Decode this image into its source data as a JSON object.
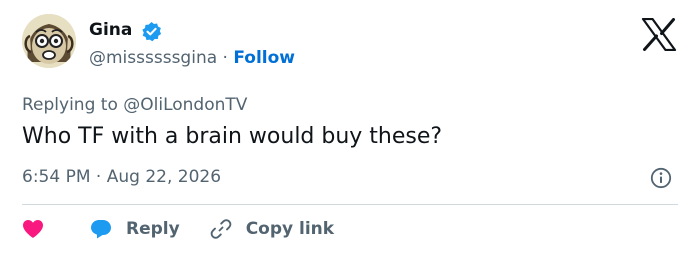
{
  "author": {
    "name": "Gina",
    "handle": "@missssssgina",
    "separator": "·",
    "follow_label": "Follow",
    "avatar_icon": "cartoon-face-avatar",
    "verified_icon": "verified-badge-icon"
  },
  "brand_icon": "x-logo-icon",
  "replying": {
    "prefix": "Replying to",
    "mention": "@OliLondonTV"
  },
  "tweet": {
    "text": "Who TF with a brain would buy these?",
    "time": "6:54 PM",
    "separator": "·",
    "date": "Aug 22, 2026",
    "info_icon": "info-icon"
  },
  "actions": {
    "like_icon": "heart-icon",
    "reply_icon": "reply-bubble-icon",
    "reply_label": "Reply",
    "copy_icon": "link-icon",
    "copy_label": "Copy link"
  },
  "colors": {
    "text": "#0f1419",
    "muted": "#536471",
    "accent": "#006fd6",
    "verified": "#1d9bf0",
    "heart": "#f91880",
    "reply": "#1d9bf0",
    "divider": "#cfd9de"
  }
}
